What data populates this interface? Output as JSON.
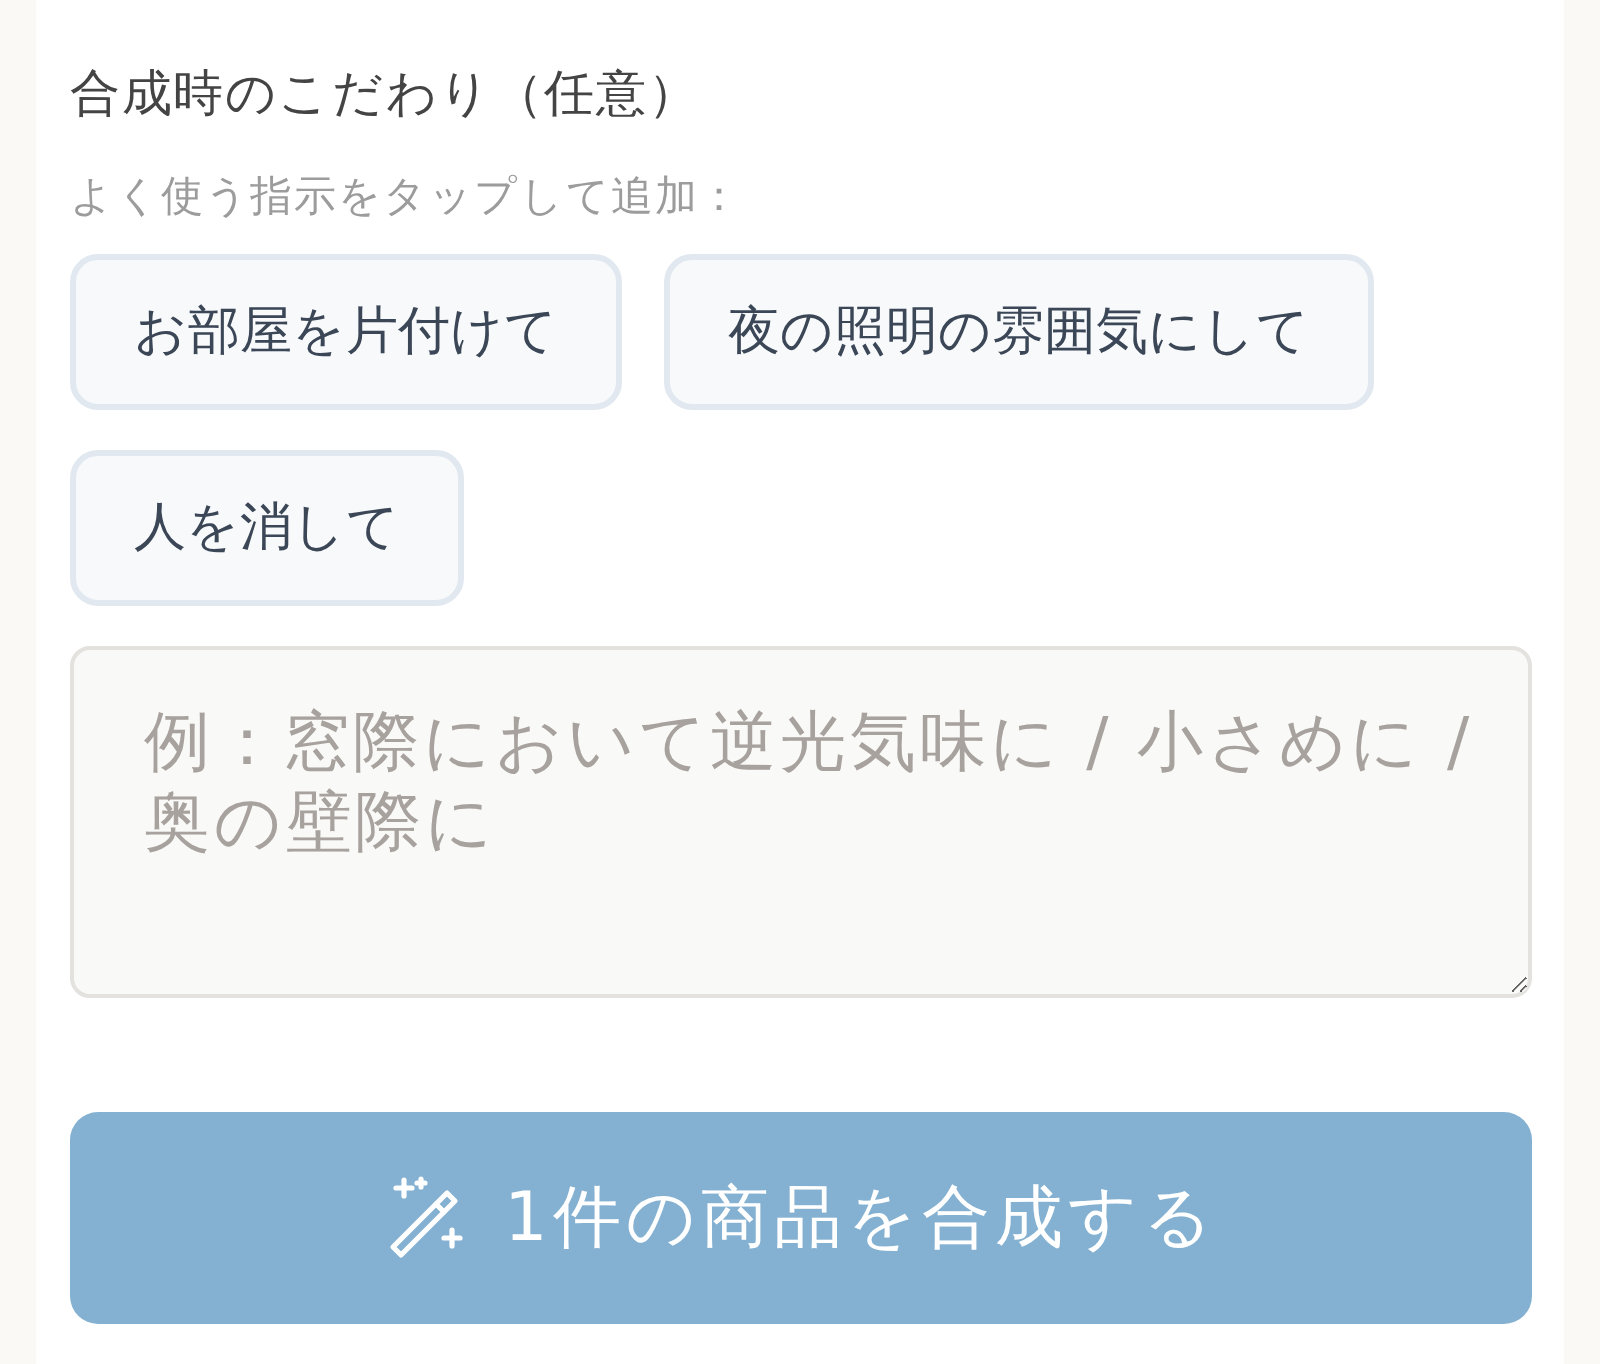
{
  "section": {
    "title": "合成時のこだわり（任意）",
    "hint": "よく使う指示をタップして追加："
  },
  "chips": [
    {
      "label": "お部屋を片付けて"
    },
    {
      "label": "夜の照明の雰囲気にして"
    },
    {
      "label": "人を消して"
    }
  ],
  "instructions_field": {
    "placeholder": "例：窓際において逆光気味に / 小さめに / 奥の壁際に"
  },
  "submit_button": {
    "label": "1件の商品を合成する"
  }
}
